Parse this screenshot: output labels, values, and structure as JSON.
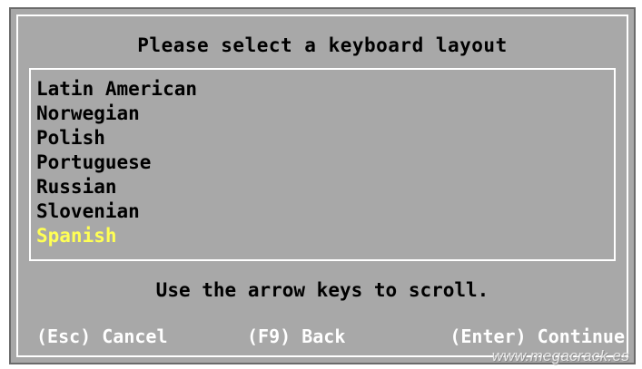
{
  "dialog": {
    "title": "Please select a keyboard layout",
    "layouts": [
      "Latin American",
      "Norwegian",
      "Polish",
      "Portuguese",
      "Russian",
      "Slovenian",
      "Spanish"
    ],
    "selected_index": 6,
    "hint": "Use the arrow keys to scroll.",
    "actions": {
      "cancel": "(Esc) Cancel",
      "back": "(F9) Back",
      "continue": "(Enter) Continue"
    }
  },
  "watermark": "www.megacrack.es",
  "colors": {
    "background": "#a8a8a8",
    "border": "#ffffff",
    "selected_text": "#ffff55",
    "text": "#000000",
    "action_text": "#ffffff"
  }
}
